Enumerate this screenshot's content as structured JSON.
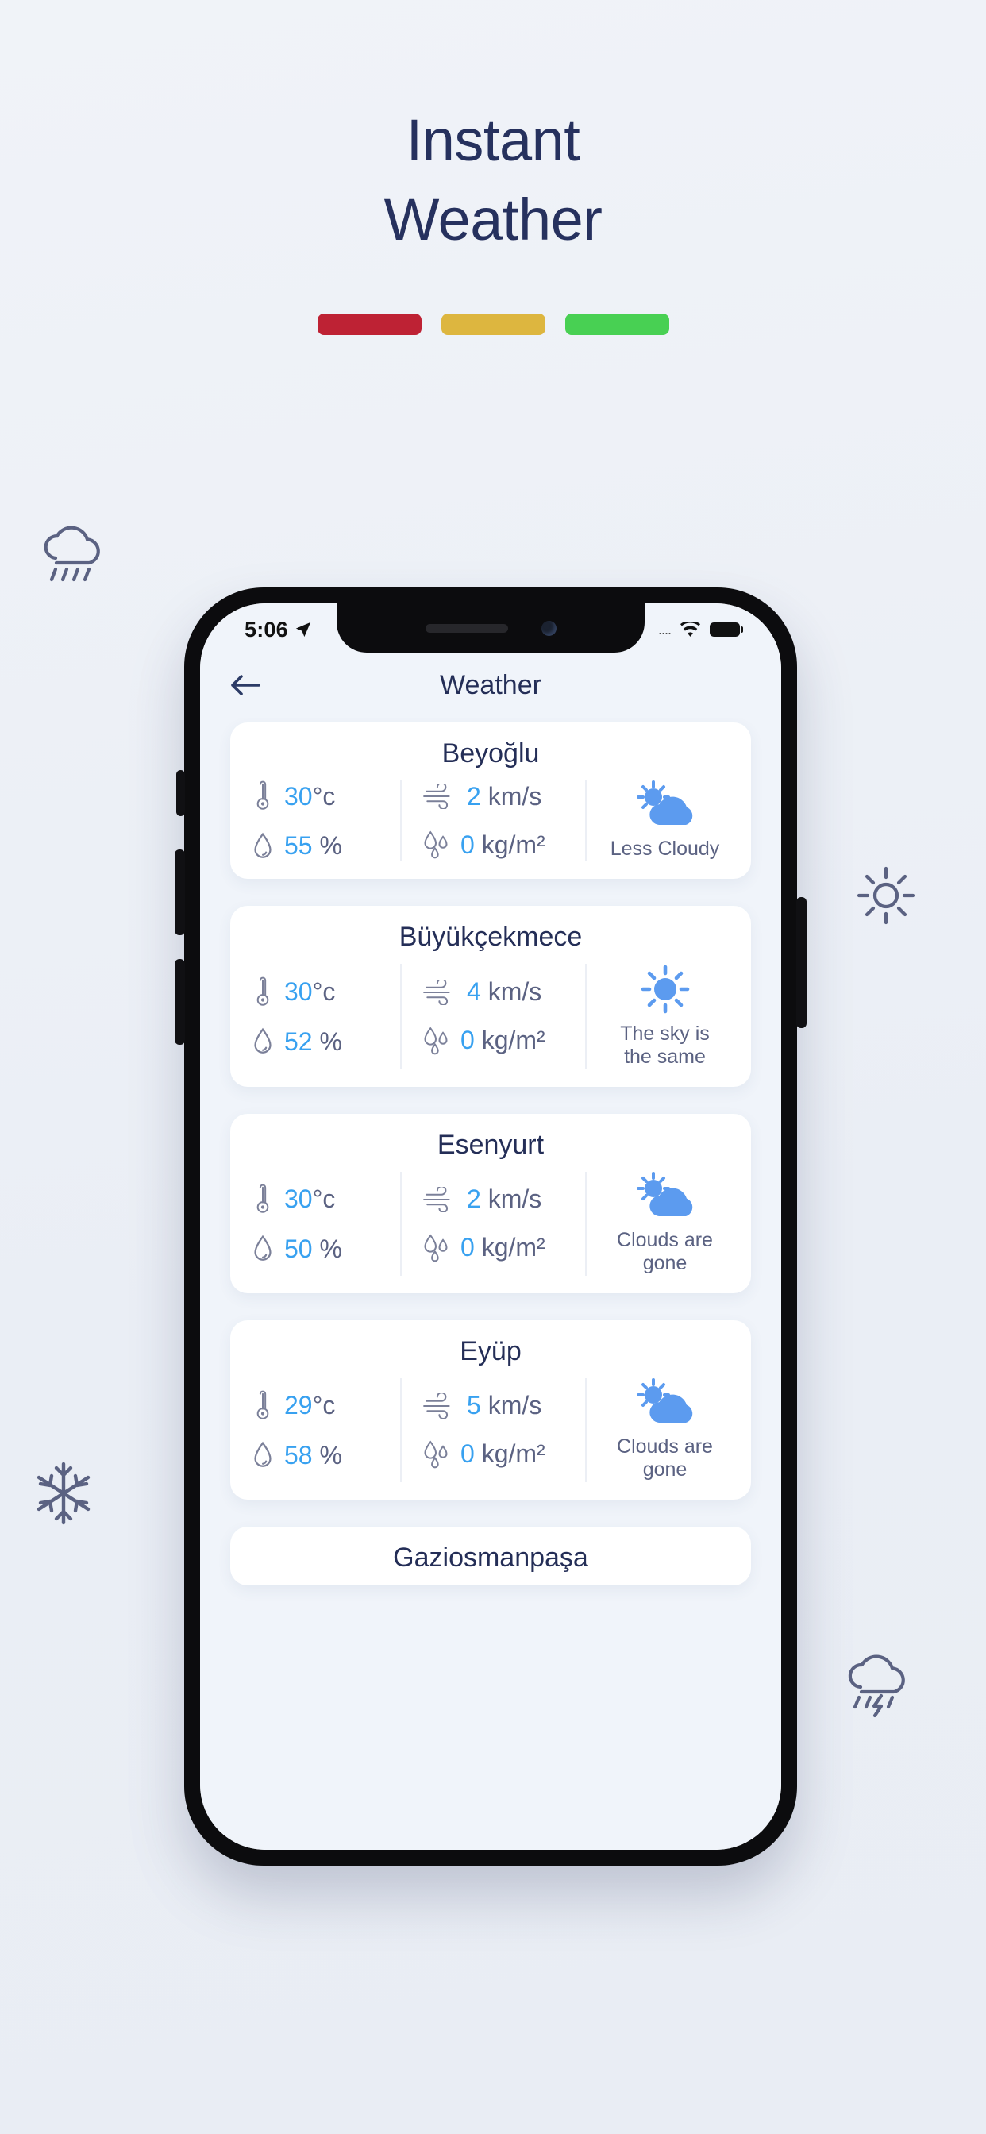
{
  "promo": {
    "title_line1": "Instant",
    "title_line2": "Weather",
    "title_color": "#26315e",
    "bars": [
      {
        "name": "bar-red",
        "color": "#be2234"
      },
      {
        "name": "bar-yellow",
        "color": "#ddb63f"
      },
      {
        "name": "bar-green",
        "color": "#48d053"
      }
    ],
    "decorations": [
      "rain-cloud-icon",
      "sun-icon",
      "snowflake-icon",
      "thunderstorm-cloud-icon"
    ]
  },
  "phone": {
    "status_bar": {
      "time": "5:06",
      "location_icon": "location-arrow-icon",
      "signal_icon": "signal-dots-icon",
      "signal_dots": "....",
      "wifi_icon": "wifi-icon",
      "battery_icon": "battery-full-icon"
    },
    "app_bar": {
      "back_icon": "back-arrow-icon",
      "title": "Weather"
    }
  },
  "theme": {
    "accent_blue": "#38a1f0",
    "weather_icon_blue": "#5c9bef",
    "title_navy": "#242e57",
    "muted_text": "#5b6282",
    "screen_bg": "#f0f4fa"
  },
  "labels": {
    "temperature_icon": "thermometer-icon",
    "humidity_icon": "water-drop-icon",
    "wind_icon": "wind-icon",
    "precipitation_icon": "rain-drops-icon"
  },
  "cards": [
    {
      "city": "Beyoğlu",
      "temperature": "30",
      "temperature_unit": "°c",
      "humidity": "55",
      "humidity_unit": "%",
      "wind": "2",
      "wind_unit": "km/s",
      "precipitation": "0",
      "precipitation_unit": "kg/m²",
      "condition": "Less Cloudy",
      "condition_icon": "sun-behind-cloud-icon"
    },
    {
      "city": "Büyükçekmece",
      "temperature": "30",
      "temperature_unit": "°c",
      "humidity": "52",
      "humidity_unit": "%",
      "wind": "4",
      "wind_unit": "km/s",
      "precipitation": "0",
      "precipitation_unit": "kg/m²",
      "condition": "The sky is the same",
      "condition_icon": "sun-icon"
    },
    {
      "city": "Esenyurt",
      "temperature": "30",
      "temperature_unit": "°c",
      "humidity": "50",
      "humidity_unit": "%",
      "wind": "2",
      "wind_unit": "km/s",
      "precipitation": "0",
      "precipitation_unit": "kg/m²",
      "condition": "Clouds are gone",
      "condition_icon": "sun-behind-cloud-icon"
    },
    {
      "city": "Eyüp",
      "temperature": "29",
      "temperature_unit": "°c",
      "humidity": "58",
      "humidity_unit": "%",
      "wind": "5",
      "wind_unit": "km/s",
      "precipitation": "0",
      "precipitation_unit": "kg/m²",
      "condition": "Clouds are gone",
      "condition_icon": "sun-behind-cloud-icon"
    },
    {
      "city": "Gaziosmanpaşa",
      "partial": true
    }
  ]
}
